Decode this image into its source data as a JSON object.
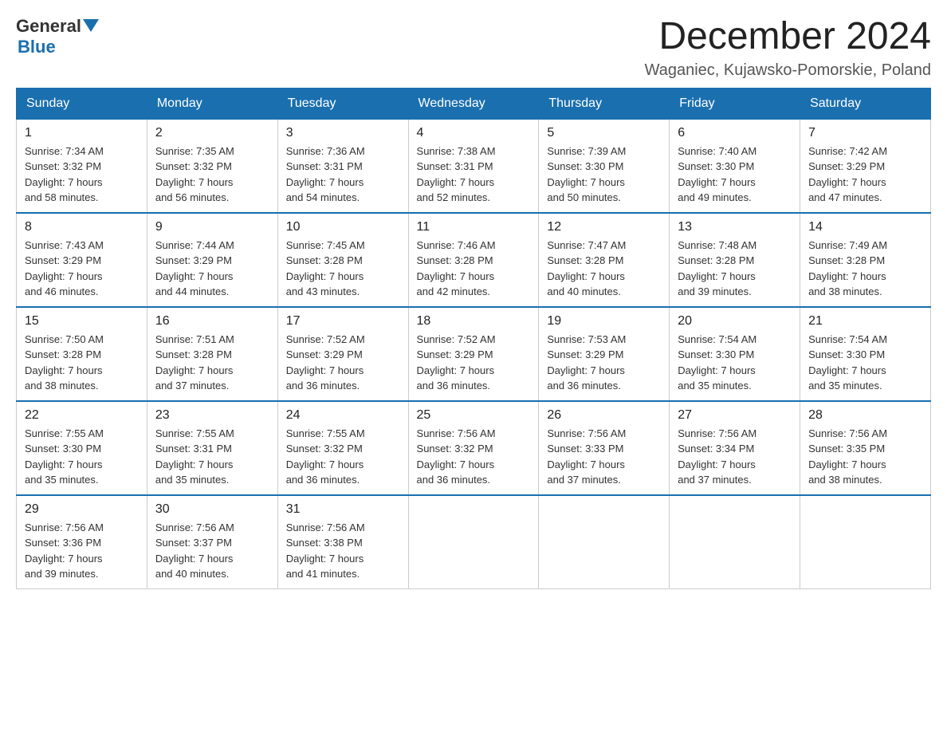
{
  "header": {
    "logo_general": "General",
    "logo_blue": "Blue",
    "month_title": "December 2024",
    "location": "Waganiec, Kujawsko-Pomorskie, Poland"
  },
  "weekdays": [
    "Sunday",
    "Monday",
    "Tuesday",
    "Wednesday",
    "Thursday",
    "Friday",
    "Saturday"
  ],
  "weeks": [
    [
      {
        "day": "1",
        "sunrise": "Sunrise: 7:34 AM",
        "sunset": "Sunset: 3:32 PM",
        "daylight": "Daylight: 7 hours",
        "daylight2": "and 58 minutes."
      },
      {
        "day": "2",
        "sunrise": "Sunrise: 7:35 AM",
        "sunset": "Sunset: 3:32 PM",
        "daylight": "Daylight: 7 hours",
        "daylight2": "and 56 minutes."
      },
      {
        "day": "3",
        "sunrise": "Sunrise: 7:36 AM",
        "sunset": "Sunset: 3:31 PM",
        "daylight": "Daylight: 7 hours",
        "daylight2": "and 54 minutes."
      },
      {
        "day": "4",
        "sunrise": "Sunrise: 7:38 AM",
        "sunset": "Sunset: 3:31 PM",
        "daylight": "Daylight: 7 hours",
        "daylight2": "and 52 minutes."
      },
      {
        "day": "5",
        "sunrise": "Sunrise: 7:39 AM",
        "sunset": "Sunset: 3:30 PM",
        "daylight": "Daylight: 7 hours",
        "daylight2": "and 50 minutes."
      },
      {
        "day": "6",
        "sunrise": "Sunrise: 7:40 AM",
        "sunset": "Sunset: 3:30 PM",
        "daylight": "Daylight: 7 hours",
        "daylight2": "and 49 minutes."
      },
      {
        "day": "7",
        "sunrise": "Sunrise: 7:42 AM",
        "sunset": "Sunset: 3:29 PM",
        "daylight": "Daylight: 7 hours",
        "daylight2": "and 47 minutes."
      }
    ],
    [
      {
        "day": "8",
        "sunrise": "Sunrise: 7:43 AM",
        "sunset": "Sunset: 3:29 PM",
        "daylight": "Daylight: 7 hours",
        "daylight2": "and 46 minutes."
      },
      {
        "day": "9",
        "sunrise": "Sunrise: 7:44 AM",
        "sunset": "Sunset: 3:29 PM",
        "daylight": "Daylight: 7 hours",
        "daylight2": "and 44 minutes."
      },
      {
        "day": "10",
        "sunrise": "Sunrise: 7:45 AM",
        "sunset": "Sunset: 3:28 PM",
        "daylight": "Daylight: 7 hours",
        "daylight2": "and 43 minutes."
      },
      {
        "day": "11",
        "sunrise": "Sunrise: 7:46 AM",
        "sunset": "Sunset: 3:28 PM",
        "daylight": "Daylight: 7 hours",
        "daylight2": "and 42 minutes."
      },
      {
        "day": "12",
        "sunrise": "Sunrise: 7:47 AM",
        "sunset": "Sunset: 3:28 PM",
        "daylight": "Daylight: 7 hours",
        "daylight2": "and 40 minutes."
      },
      {
        "day": "13",
        "sunrise": "Sunrise: 7:48 AM",
        "sunset": "Sunset: 3:28 PM",
        "daylight": "Daylight: 7 hours",
        "daylight2": "and 39 minutes."
      },
      {
        "day": "14",
        "sunrise": "Sunrise: 7:49 AM",
        "sunset": "Sunset: 3:28 PM",
        "daylight": "Daylight: 7 hours",
        "daylight2": "and 38 minutes."
      }
    ],
    [
      {
        "day": "15",
        "sunrise": "Sunrise: 7:50 AM",
        "sunset": "Sunset: 3:28 PM",
        "daylight": "Daylight: 7 hours",
        "daylight2": "and 38 minutes."
      },
      {
        "day": "16",
        "sunrise": "Sunrise: 7:51 AM",
        "sunset": "Sunset: 3:28 PM",
        "daylight": "Daylight: 7 hours",
        "daylight2": "and 37 minutes."
      },
      {
        "day": "17",
        "sunrise": "Sunrise: 7:52 AM",
        "sunset": "Sunset: 3:29 PM",
        "daylight": "Daylight: 7 hours",
        "daylight2": "and 36 minutes."
      },
      {
        "day": "18",
        "sunrise": "Sunrise: 7:52 AM",
        "sunset": "Sunset: 3:29 PM",
        "daylight": "Daylight: 7 hours",
        "daylight2": "and 36 minutes."
      },
      {
        "day": "19",
        "sunrise": "Sunrise: 7:53 AM",
        "sunset": "Sunset: 3:29 PM",
        "daylight": "Daylight: 7 hours",
        "daylight2": "and 36 minutes."
      },
      {
        "day": "20",
        "sunrise": "Sunrise: 7:54 AM",
        "sunset": "Sunset: 3:30 PM",
        "daylight": "Daylight: 7 hours",
        "daylight2": "and 35 minutes."
      },
      {
        "day": "21",
        "sunrise": "Sunrise: 7:54 AM",
        "sunset": "Sunset: 3:30 PM",
        "daylight": "Daylight: 7 hours",
        "daylight2": "and 35 minutes."
      }
    ],
    [
      {
        "day": "22",
        "sunrise": "Sunrise: 7:55 AM",
        "sunset": "Sunset: 3:30 PM",
        "daylight": "Daylight: 7 hours",
        "daylight2": "and 35 minutes."
      },
      {
        "day": "23",
        "sunrise": "Sunrise: 7:55 AM",
        "sunset": "Sunset: 3:31 PM",
        "daylight": "Daylight: 7 hours",
        "daylight2": "and 35 minutes."
      },
      {
        "day": "24",
        "sunrise": "Sunrise: 7:55 AM",
        "sunset": "Sunset: 3:32 PM",
        "daylight": "Daylight: 7 hours",
        "daylight2": "and 36 minutes."
      },
      {
        "day": "25",
        "sunrise": "Sunrise: 7:56 AM",
        "sunset": "Sunset: 3:32 PM",
        "daylight": "Daylight: 7 hours",
        "daylight2": "and 36 minutes."
      },
      {
        "day": "26",
        "sunrise": "Sunrise: 7:56 AM",
        "sunset": "Sunset: 3:33 PM",
        "daylight": "Daylight: 7 hours",
        "daylight2": "and 37 minutes."
      },
      {
        "day": "27",
        "sunrise": "Sunrise: 7:56 AM",
        "sunset": "Sunset: 3:34 PM",
        "daylight": "Daylight: 7 hours",
        "daylight2": "and 37 minutes."
      },
      {
        "day": "28",
        "sunrise": "Sunrise: 7:56 AM",
        "sunset": "Sunset: 3:35 PM",
        "daylight": "Daylight: 7 hours",
        "daylight2": "and 38 minutes."
      }
    ],
    [
      {
        "day": "29",
        "sunrise": "Sunrise: 7:56 AM",
        "sunset": "Sunset: 3:36 PM",
        "daylight": "Daylight: 7 hours",
        "daylight2": "and 39 minutes."
      },
      {
        "day": "30",
        "sunrise": "Sunrise: 7:56 AM",
        "sunset": "Sunset: 3:37 PM",
        "daylight": "Daylight: 7 hours",
        "daylight2": "and 40 minutes."
      },
      {
        "day": "31",
        "sunrise": "Sunrise: 7:56 AM",
        "sunset": "Sunset: 3:38 PM",
        "daylight": "Daylight: 7 hours",
        "daylight2": "and 41 minutes."
      },
      null,
      null,
      null,
      null
    ]
  ]
}
